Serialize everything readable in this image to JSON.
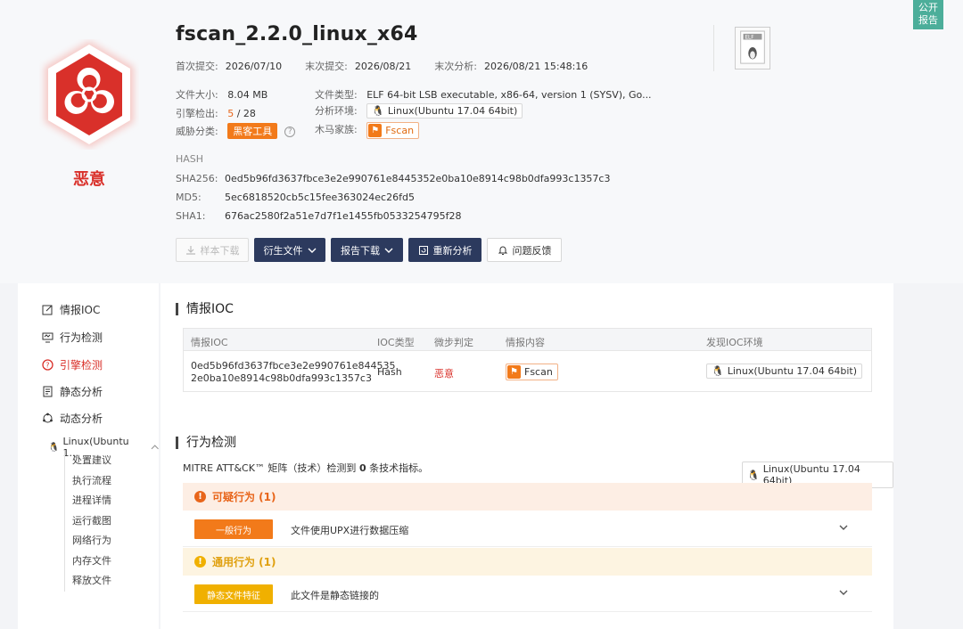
{
  "public_report": "公开\n报告",
  "verdict": "恶意",
  "file": {
    "name": "fscan_2.2.0_linux_x64",
    "first_submit_label": "首次提交:",
    "first_submit": "2026/07/10",
    "last_submit_label": "末次提交:",
    "last_submit": "2026/08/21",
    "last_analysis_label": "末次分析:",
    "last_analysis": "2026/08/21 15:48:16",
    "size_label": "文件大小:",
    "size": "8.04 MB",
    "engines_label": "引擎检出:",
    "engines_hit": "5",
    "engines_total": " / 28",
    "threat_label": "威胁分类:",
    "threat": "黑客工具",
    "type_label": "文件类型:",
    "type": "ELF 64-bit LSB executable, x86-64, version 1 (SYSV), Go...",
    "env_label": "分析环境:",
    "env": "Linux(Ubuntu 17.04 64bit)",
    "family_label": "木马家族:",
    "family": "Fscan",
    "elf_badge": "ELF"
  },
  "hash": {
    "title": "HASH",
    "sha256_label": "SHA256:",
    "sha256": "0ed5b96fd3637fbce3e2e990761e8445352e0ba10e8914c98b0dfa993c1357c3",
    "md5_label": "MD5:",
    "md5": "5ec6818520cb5c15fee363024ec26fd5",
    "sha1_label": "SHA1:",
    "sha1": "676ac2580f2a51e7d7f1e1455fb0533254795f28"
  },
  "toolbar": {
    "download_sample": "样本下载",
    "derived_files": "衍生文件",
    "report_download": "报告下载",
    "reanalyze": "重新分析",
    "feedback": "问题反馈"
  },
  "sidebar": {
    "items": [
      {
        "label": "情报IOC",
        "icon": "edit-icon"
      },
      {
        "label": "行为检测",
        "icon": "monitor-icon"
      },
      {
        "label": "引擎检测",
        "icon": "help-circle-icon"
      },
      {
        "label": "静态分析",
        "icon": "document-icon"
      },
      {
        "label": "动态分析",
        "icon": "cycle-icon"
      }
    ],
    "env_parent": "Linux(Ubuntu 1...",
    "subitems": [
      "处置建议",
      "执行流程",
      "进程详情",
      "运行截图",
      "网络行为",
      "内存文件",
      "释放文件"
    ]
  },
  "ioc": {
    "title": "情报IOC",
    "headers": [
      "情报IOC",
      "IOC类型",
      "微步判定",
      "情报内容",
      "发现IOC环境"
    ],
    "row": {
      "ioc_line1": "0ed5b96fd3637fbce3e2e990761e844535",
      "ioc_line2": "2e0ba10e8914c98b0dfa993c1357c3",
      "type": "Hash",
      "judgement": "恶意",
      "content": "Fscan",
      "env": "Linux(Ubuntu 17.04 64bit)"
    }
  },
  "behavior": {
    "title": "行为检测",
    "mitre_prefix": "MITRE ATT&CK™ 矩阵（技术）检测到 ",
    "mitre_count": "0",
    "mitre_suffix": " 条技术指标。",
    "env": "Linux(Ubuntu 17.04 64bit)",
    "suspicious_title": "可疑行为 (1)",
    "suspicious_tag": "一般行为",
    "suspicious_text": "文件使用UPX进行数据压缩",
    "general_title": "通用行为 (1)",
    "general_tag": "静态文件特征",
    "general_text": "此文件是静态链接的"
  },
  "colors": {
    "malicious": "#d9302a",
    "accent_dark": "#2c3a5e",
    "orange": "#f27a1a",
    "yellow": "#f0b000",
    "teal": "#4cae9a"
  }
}
